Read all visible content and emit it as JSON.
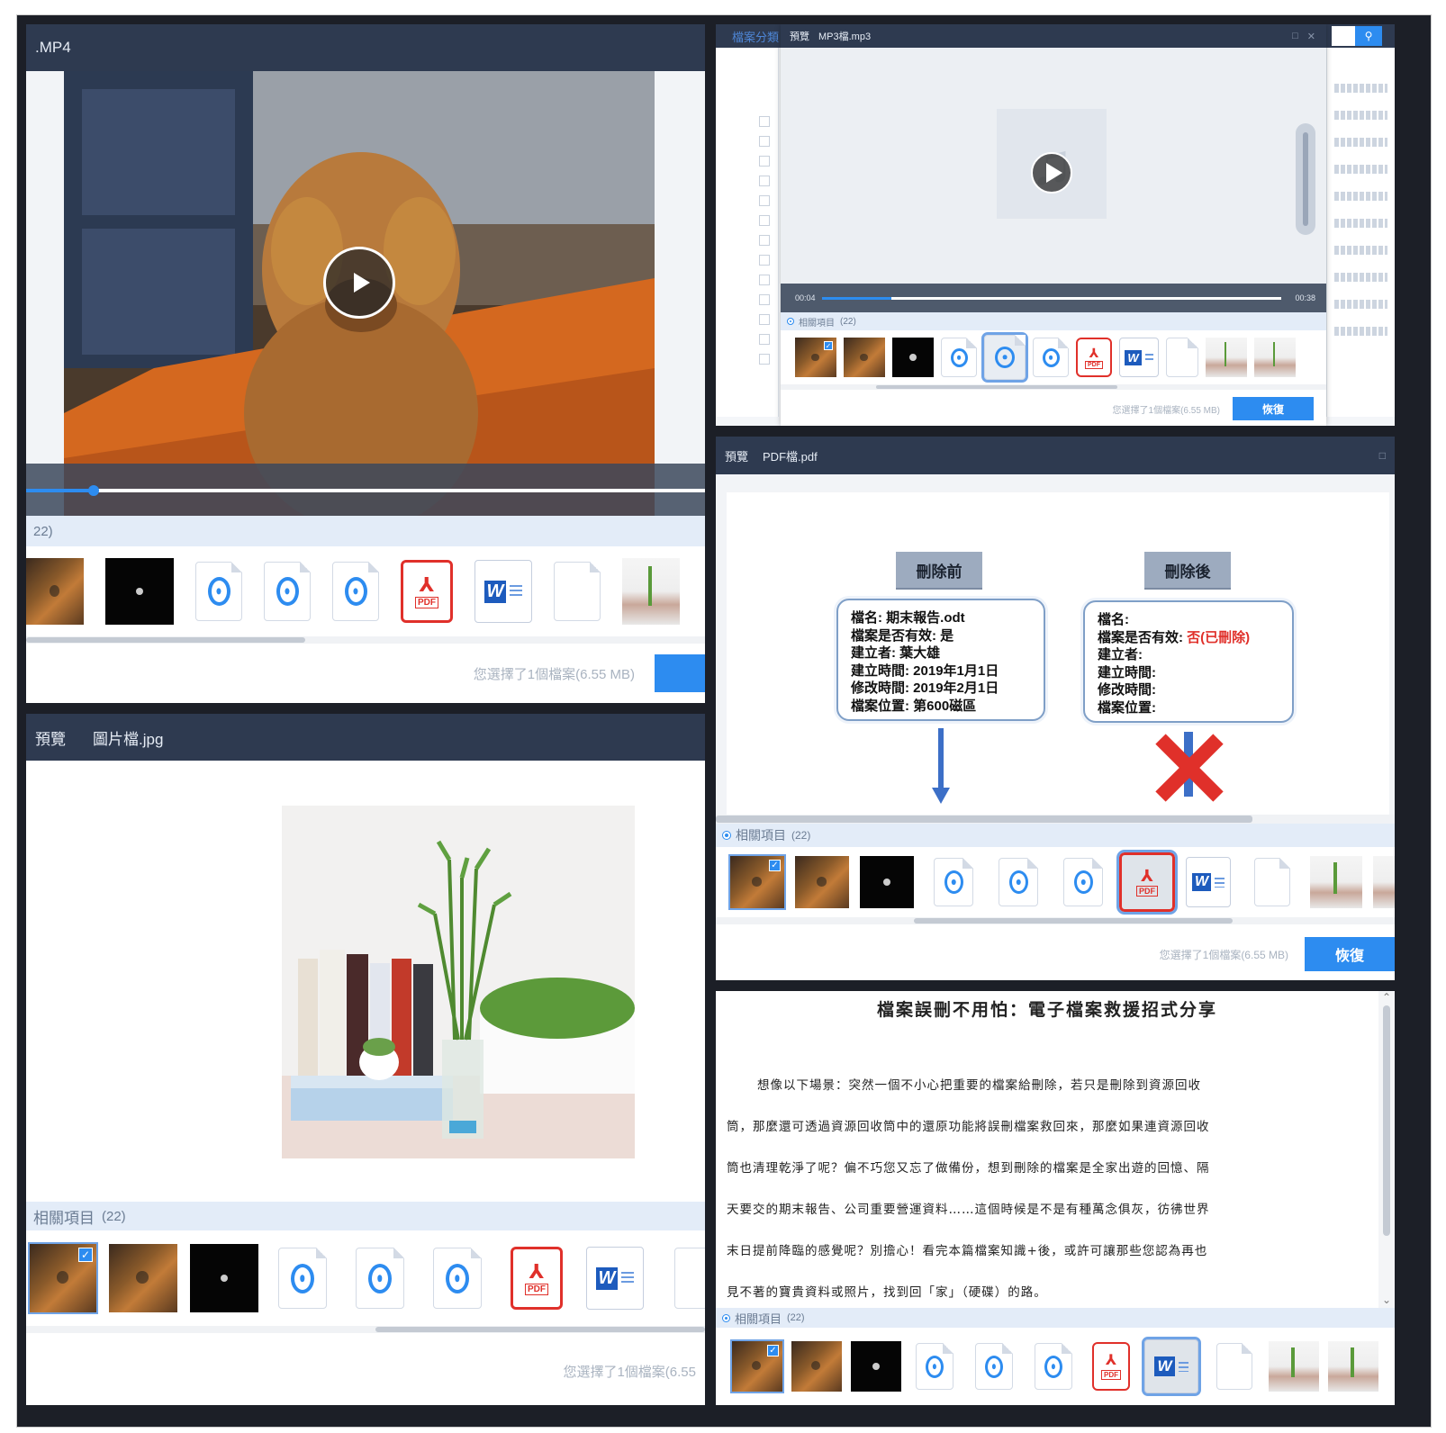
{
  "video_panel": {
    "title": ".MP4",
    "related_count": "22)",
    "status": "您選擇了1個檔案(6.55 MB)",
    "progress": 0.1
  },
  "audio_panel": {
    "left_tab": "檔案分類",
    "title_tag": "預覽",
    "file_name": "MP3檔.mp3",
    "time_start": "00:04",
    "time_end": "00:38",
    "related_label": "相關項目",
    "related_count": "(22)",
    "status": "您選擇了1個檔案(6.55 MB)",
    "recover": "恢復",
    "progress": 0.15
  },
  "image_panel": {
    "title_tag": "預覽",
    "file_name": "圖片檔.jpg",
    "related_label": "相關項目",
    "related_count": "(22)",
    "status": "您選擇了1個檔案(6.55"
  },
  "pdf_panel": {
    "title_tag": "預覽",
    "file_name": "PDF檔.pdf",
    "before_label": "刪除前",
    "after_label": "刪除後",
    "before_lines": [
      "檔名: 期末報告.odt",
      "檔案是否有效: 是",
      "建立者: 葉大雄",
      "建立時間: 2019年1月1日",
      "修改時間: 2019年2月1日",
      "檔案位置: 第600磁區"
    ],
    "after_lines": [
      "檔名:",
      "檔案是否有效:",
      "建立者:",
      "建立時間:",
      "修改時間:",
      "檔案位置:"
    ],
    "after_invalid": "否(已刪除)",
    "related_label": "相關項目",
    "related_count": "(22)",
    "status": "您選擇了1個檔案(6.55 MB)",
    "recover": "恢復"
  },
  "doc_panel": {
    "heading": "檔案誤刪不用怕：電子檔案救援招式分享",
    "paragraph_lines": [
      "想像以下場景：突然一個不小心把重要的檔案給刪除，若只是刪除到資源回收",
      "筒，那麼還可透過資源回收筒中的還原功能將誤刪檔案救回來，那麼如果連資源回收",
      "筒也清理乾淨了呢？偏不巧您又忘了做備份，想到刪除的檔案是全家出遊的回憶、隔",
      "天要交的期末報告、公司重要營運資料……這個時候是不是有種萬念俱灰，彷彿世界",
      "末日提前降臨的感覺呢？別擔心！看完本篇檔案知識+後，或許可讓那些您認為再也",
      "見不著的寶貴資料或照片，找到回「家」（硬碟）的路。"
    ],
    "related_label": "相關項目",
    "related_count": "(22)"
  },
  "icons": {
    "audio": "audio-file-icon",
    "pdf": "pdf-file-icon",
    "word": "word-file-icon",
    "blank": "blank-file-icon",
    "pdf_glyph": "⅄",
    "pdf_text": "PDF",
    "word_letter": "W",
    "check": "✓"
  },
  "colors": {
    "accent": "#2d8cf0",
    "titlebar": "#2e3a50",
    "invalid": "#e0302a"
  }
}
